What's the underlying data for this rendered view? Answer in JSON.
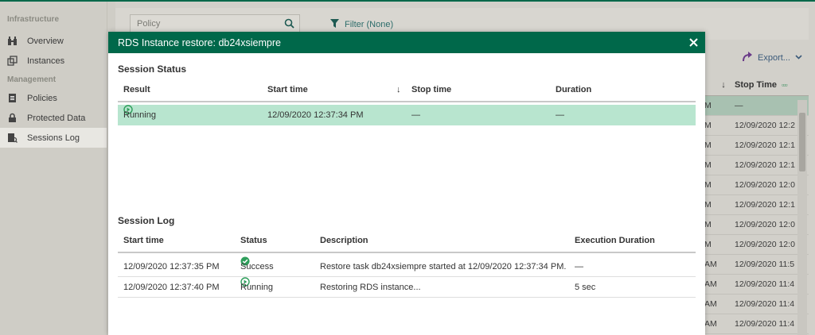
{
  "sidebar": {
    "sections": [
      {
        "title": "Infrastructure",
        "items": [
          {
            "label": "Overview",
            "icon": "binoculars-icon"
          },
          {
            "label": "Instances",
            "icon": "instances-icon"
          }
        ]
      },
      {
        "title": "Management",
        "items": [
          {
            "label": "Policies",
            "icon": "policies-icon"
          },
          {
            "label": "Protected Data",
            "icon": "lock-icon"
          },
          {
            "label": "Sessions Log",
            "icon": "sessions-log-icon",
            "active": true
          }
        ]
      }
    ]
  },
  "toolbar": {
    "search_placeholder": "Policy",
    "filter_label": "Filter (None)",
    "export_label": "Export..."
  },
  "background_table": {
    "header_sort": "↓",
    "header_col": "Stop Time",
    "header_dots": "▫▫▫",
    "rows": [
      {
        "c1": "M",
        "c2": "—"
      },
      {
        "c1": "M",
        "c2": "12/09/2020 12:2"
      },
      {
        "c1": "M",
        "c2": "12/09/2020 12:1"
      },
      {
        "c1": "M",
        "c2": "12/09/2020 12:1"
      },
      {
        "c1": "M",
        "c2": "12/09/2020 12:0"
      },
      {
        "c1": "M",
        "c2": "12/09/2020 12:1"
      },
      {
        "c1": "M",
        "c2": "12/09/2020 12:0"
      },
      {
        "c1": "M",
        "c2": "12/09/2020 12:0"
      },
      {
        "c1": "AM",
        "c2": "12/09/2020 11:5"
      },
      {
        "c1": "AM",
        "c2": "12/09/2020 11:4"
      },
      {
        "c1": "AM",
        "c2": "12/09/2020 11:4"
      },
      {
        "c1": "AM",
        "c2": "12/09/2020 11:4"
      }
    ]
  },
  "modal": {
    "title": "RDS Instance restore: db24xsiempre",
    "session_status": {
      "title": "Session Status",
      "columns": {
        "result": "Result",
        "start": "Start time",
        "sort": "↓",
        "stop": "Stop time",
        "duration": "Duration"
      },
      "row": {
        "result": "Running",
        "start": "12/09/2020 12:37:34 PM",
        "stop": "—",
        "duration": "—"
      }
    },
    "session_log": {
      "title": "Session Log",
      "columns": {
        "start": "Start time",
        "status": "Status",
        "description": "Description",
        "duration": "Execution Duration"
      },
      "rows": [
        {
          "start": "12/09/2020 12:37:35 PM",
          "status": "Success",
          "status_icon": "check-circle-icon",
          "description": "Restore task db24xsiempre started at 12/09/2020 12:37:34 PM.",
          "duration": "—"
        },
        {
          "start": "12/09/2020 12:37:40 PM",
          "status": "Running",
          "status_icon": "play-circle-icon",
          "description": "Restoring RDS instance...",
          "duration": "5 sec"
        }
      ]
    }
  },
  "colors": {
    "brand_green": "#00684a",
    "running_row": "#b8e5cf",
    "success_green": "#2e9e5b",
    "link_teal": "#2c6c6a"
  }
}
